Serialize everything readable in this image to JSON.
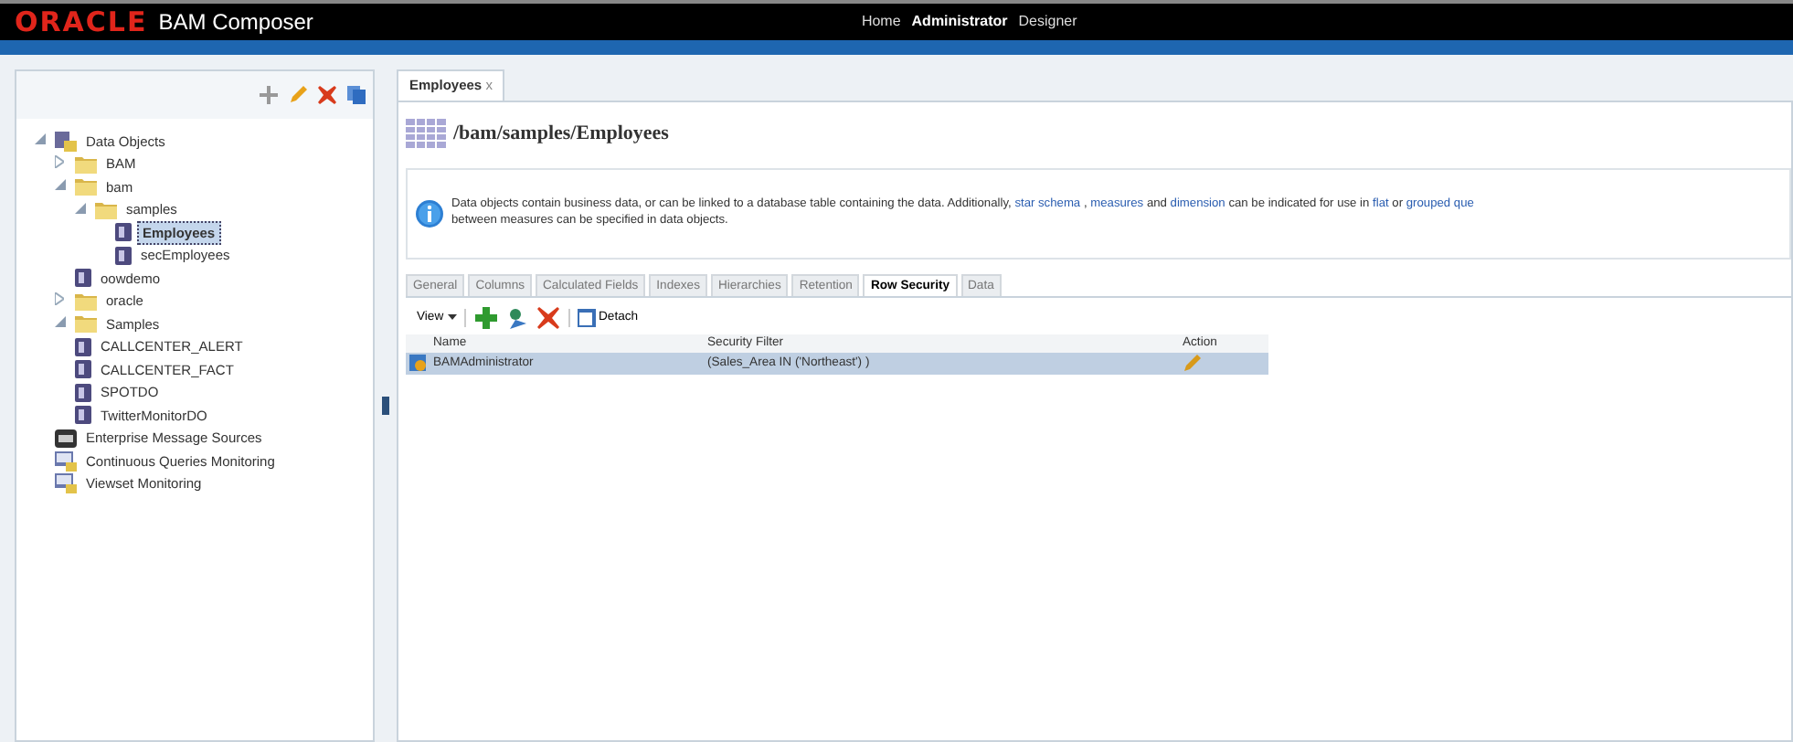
{
  "header": {
    "logo": "ORACLE",
    "product": "BAM Composer",
    "nav": [
      {
        "label": "Home",
        "selected": false
      },
      {
        "label": "Administrator",
        "selected": true
      },
      {
        "label": "Designer",
        "selected": false
      }
    ]
  },
  "sidebar": {
    "tree": [
      {
        "label": "Data Objects",
        "kind": "root",
        "expanded": true,
        "selected": false,
        "children": [
          {
            "label": "BAM",
            "kind": "folder",
            "expanded": false,
            "selected": false
          },
          {
            "label": "bam",
            "kind": "folder",
            "expanded": true,
            "selected": false,
            "children": [
              {
                "label": "samples",
                "kind": "folder",
                "expanded": true,
                "selected": false,
                "children": [
                  {
                    "label": "Employees",
                    "kind": "dataobject",
                    "selected": true
                  },
                  {
                    "label": "secEmployees",
                    "kind": "dataobject",
                    "selected": false
                  }
                ]
              }
            ]
          },
          {
            "label": "oowdemo",
            "kind": "dataobject",
            "selected": false
          },
          {
            "label": "oracle",
            "kind": "folder",
            "expanded": false,
            "selected": false
          },
          {
            "label": "Samples",
            "kind": "folder",
            "expanded": true,
            "selected": false
          },
          {
            "label": "CALLCENTER_ALERT",
            "kind": "dataobject",
            "selected": false
          },
          {
            "label": "CALLCENTER_FACT",
            "kind": "dataobject",
            "selected": false
          },
          {
            "label": "SPOTDO",
            "kind": "dataobject",
            "selected": false
          },
          {
            "label": "TwitterMonitorDO",
            "kind": "dataobject",
            "selected": false
          }
        ]
      },
      {
        "label": "Enterprise Message Sources",
        "kind": "ems",
        "selected": false
      },
      {
        "label": "Continuous Queries Monitoring",
        "kind": "monitor",
        "selected": false
      },
      {
        "label": "Viewset Monitoring",
        "kind": "monitor",
        "selected": false
      }
    ]
  },
  "doc_tabs": [
    {
      "label": "Employees",
      "close": "x",
      "selected": true
    }
  ],
  "path": "/bam/samples/Employees",
  "info": {
    "lines": [
      [
        {
          "kind": "text",
          "text": "Data objects contain business data, or can be linked to a database table containing the data. Additionally,"
        },
        {
          "kind": "link",
          "text": "star schema"
        },
        {
          "kind": "text",
          "text": ","
        },
        {
          "kind": "link",
          "text": "measures"
        },
        {
          "kind": "text",
          "text": "and"
        },
        {
          "kind": "link",
          "text": "dimension"
        },
        {
          "kind": "text",
          "text": "can be indicated for use in"
        },
        {
          "kind": "link",
          "text": "flat"
        },
        {
          "kind": "text",
          "text": "or"
        },
        {
          "kind": "link",
          "text": "grouped que"
        }
      ],
      [
        {
          "kind": "text",
          "text": "between measures can be specified in data objects."
        }
      ]
    ]
  },
  "tabs": [
    {
      "label": "General",
      "selected": false
    },
    {
      "label": "Columns",
      "selected": false
    },
    {
      "label": "Calculated Fields",
      "selected": false
    },
    {
      "label": "Indexes",
      "selected": false
    },
    {
      "label": "Hierarchies",
      "selected": false
    },
    {
      "label": "Retention",
      "selected": false
    },
    {
      "label": "Row Security",
      "selected": true
    },
    {
      "label": "Data",
      "selected": false
    }
  ],
  "toolbar": {
    "view": "View",
    "detach": "Detach"
  },
  "table": {
    "columns": [
      "Name",
      "Security Filter",
      "Action"
    ],
    "rows": [
      {
        "name": "BAMAdministrator",
        "filter": "(Sales_Area IN ('Northeast') )",
        "selected": true
      }
    ]
  }
}
